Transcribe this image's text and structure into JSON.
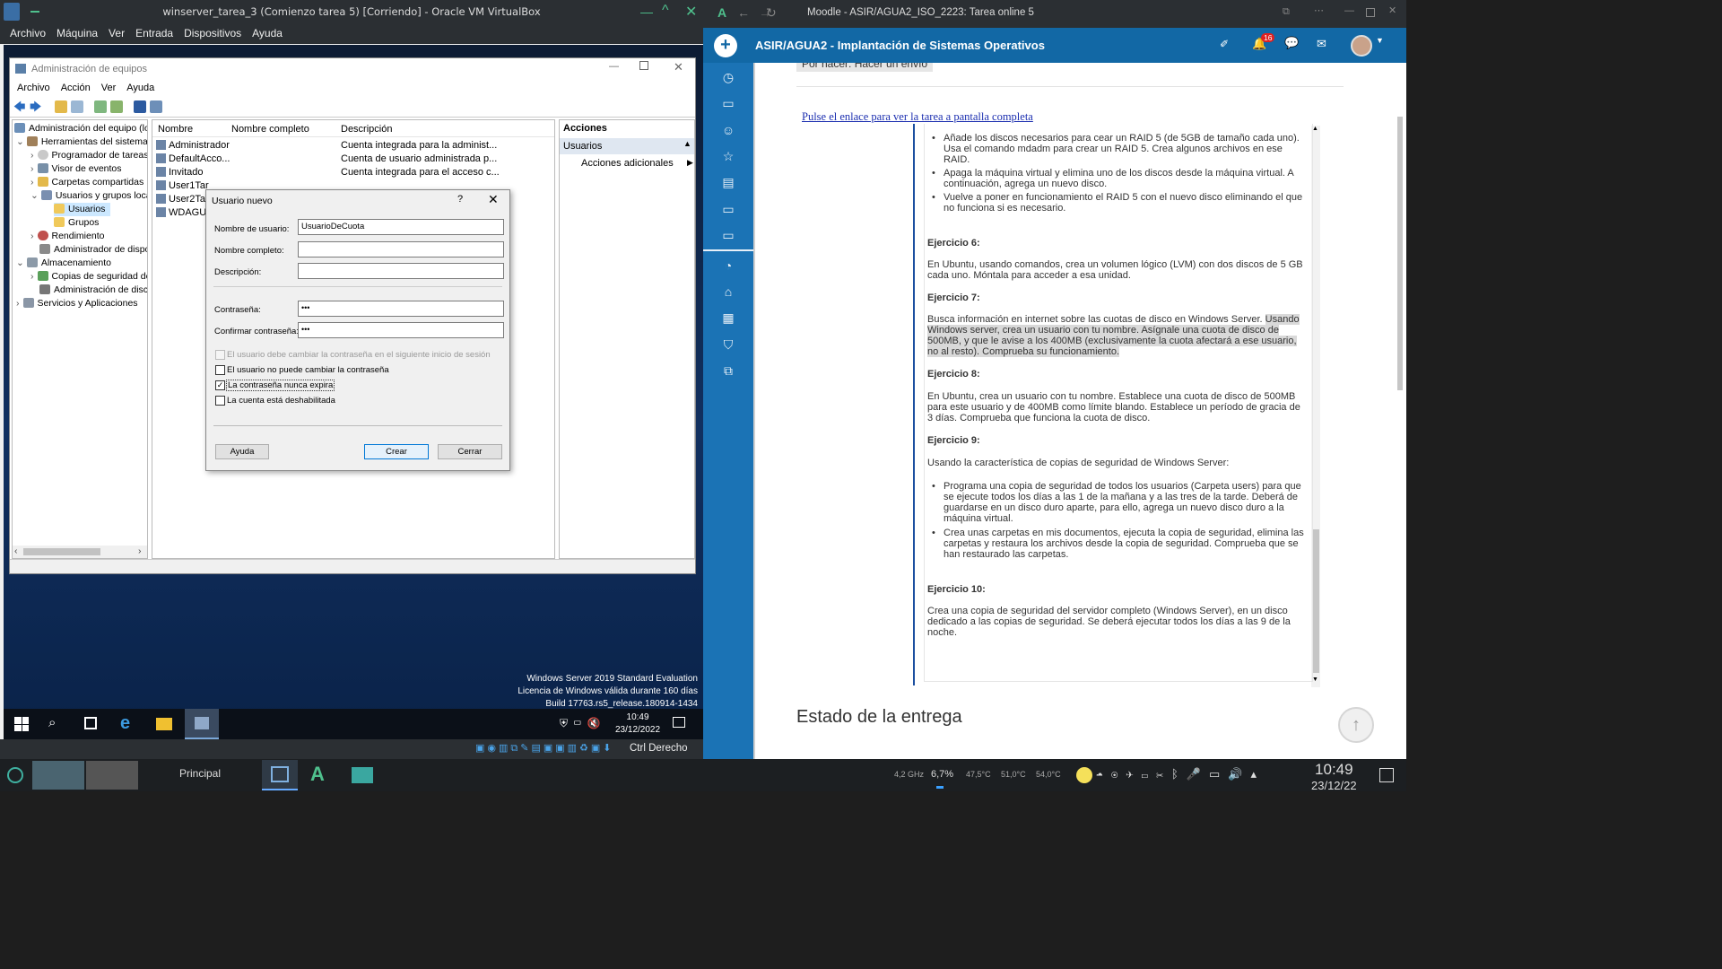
{
  "vbox": {
    "title": "winserver_tarea_3 (Comienzo tarea 5) [Corriendo] - Oracle VM VirtualBox",
    "menu": [
      "Archivo",
      "Máquina",
      "Ver",
      "Entrada",
      "Dispositivos",
      "Ayuda"
    ],
    "status_host_key": "Ctrl Derecho"
  },
  "cm": {
    "title": "Administración de equipos",
    "menu": [
      "Archivo",
      "Acción",
      "Ver",
      "Ayuda"
    ],
    "tree": [
      "Administración del equipo (loc",
      "Herramientas del sistema",
      "Programador de tareas",
      "Visor de eventos",
      "Carpetas compartidas",
      "Usuarios y grupos locale",
      "Usuarios",
      "Grupos",
      "Rendimiento",
      "Administrador de dispo",
      "Almacenamiento",
      "Copias de seguridad de",
      "Administración de disco",
      "Servicios y Aplicaciones"
    ],
    "columns": [
      "Nombre",
      "Nombre completo",
      "Descripción"
    ],
    "rows": [
      {
        "name": "Administrador",
        "desc": "Cuenta integrada para la administ..."
      },
      {
        "name": "DefaultAcco...",
        "desc": "Cuenta de usuario administrada p..."
      },
      {
        "name": "Invitado",
        "desc": "Cuenta integrada para el acceso c..."
      },
      {
        "name": "User1Tar",
        "desc": ""
      },
      {
        "name": "User2Tar",
        "desc": ""
      },
      {
        "name": "WDAGU",
        "desc": ""
      }
    ],
    "actions_header": "Acciones",
    "actions_section": "Usuarios",
    "actions_more": "Acciones adicionales"
  },
  "dialog": {
    "title": "Usuario nuevo",
    "help_glyph": "?",
    "username_label": "Nombre de usuario:",
    "username_value": "UsuarioDeCuota",
    "fullname_label": "Nombre completo:",
    "desc_label": "Descripción:",
    "pwd_label": "Contraseña:",
    "pwd_value": "•••",
    "pwd2_label": "Confirmar contraseña:",
    "pwd2_value": "•••",
    "chk1": "El usuario debe cambiar la contraseña en el siguiente inicio de sesión",
    "chk2": "El usuario no puede cambiar la contraseña",
    "chk3": "La contraseña nunca expira",
    "chk4": "La cuenta está deshabilitada",
    "btn_help": "Ayuda",
    "btn_create": "Crear",
    "btn_close": "Cerrar"
  },
  "guest": {
    "watermark": [
      "Windows Server 2019 Standard Evaluation",
      "Licencia de Windows válida durante 160 días",
      "Build 17763.rs5_release.180914-1434"
    ],
    "time": "10:49",
    "date": "23/12/2022"
  },
  "browser": {
    "title": "Moodle - ASIR/AGUA2_ISO_2223: Tarea online 5",
    "course": "ASIR/AGUA2 - Implantación de Sistemas Operativos",
    "notif_count": "16",
    "top_clip": "Por hacer: Hacer un envío",
    "full_link": "Pulse el enlace para ver la tarea a pantalla completa",
    "bullets_top": [
      "Añade los discos necesarios para cear un RAID 5 (de 5GB de tamaño cada uno). Usa el comando mdadm para crear un RAID 5.  Crea algunos archivos en ese RAID.",
      "Apaga la máquina virtual y elimina uno de los discos desde la máquina virtual. A continuación, agrega un nuevo disco.",
      "Vuelve a poner en funcionamiento el RAID 5 con el nuevo disco eliminando el que no funciona si es necesario."
    ],
    "ex6_title": "Ejercicio 6:",
    "ex6_text": "En Ubuntu, usando comandos, crea un volumen lógico (LVM) con dos discos de 5 GB cada uno.  Móntala para acceder a esa unidad.",
    "ex7_title": "Ejercicio 7:",
    "ex7_text_a": "Busca información en internet sobre las cuotas de disco en Windows Server.",
    "ex7_text_b": "Usando Windows server, crea un usuario con tu nombre.  Asígnale una cuota de disco de 500MB, y que le avise a los 400MB (exclusivamente la cuota afectará a ese usuario, no al resto).  Comprueba su funcionamiento.",
    "ex8_title": "Ejercicio 8:",
    "ex8_text": "En Ubuntu, crea un usuario con tu nombre.  Establece una cuota de disco de 500MB para este usuario y de 400MB como límite blando.  Establece un período de gracia de 3 días.  Comprueba que funciona la cuota de disco.",
    "ex9_title": "Ejercicio 9:",
    "ex9_text": "Usando la característica de copias de seguridad de Windows Server:",
    "ex9_bullets": [
      "Programa una copia de seguridad de todos los usuarios (Carpeta users) para que se ejecute todos los días a las 1 de la mañana y a las tres de la tarde. Deberá de guardarse en un disco duro aparte, para ello, agrega un nuevo disco duro a la máquina virtual.",
      "Crea unas carpetas en mis documentos, ejecuta la copia de seguridad, elimina las carpetas y restaura los archivos desde la copia de seguridad. Comprueba que se han restaurado las carpetas."
    ],
    "ex10_title": "Ejercicio 10:",
    "ex10_text": "Crea una copia de seguridad del servidor completo (Windows Server), en un disco dedicado a las copias de seguridad.  Se deberá ejecutar todos los días a las 9 de la noche.",
    "status_heading": "Estado de la entrega"
  },
  "host_task": {
    "workspace": "Principal",
    "cpu_freq": "4,2 GHz",
    "cpu_load": "6,7%",
    "temp1": "47,5°C",
    "temp2": "51,0°C",
    "temp3": "54,0°C",
    "time": "10:49",
    "date": "23/12/22"
  },
  "colors": {
    "moodle_blue": "#1268a5",
    "side_blue": "#1b73b5",
    "highlight": "#d9d9d9"
  }
}
